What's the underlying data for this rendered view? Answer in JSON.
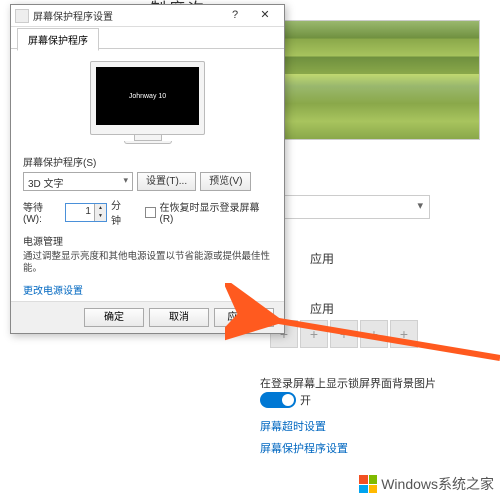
{
  "background": {
    "header_partial": "制度次",
    "section_usage": "应用",
    "section_related": "应用",
    "toggle_label": "在登录屏幕上显示锁屏界面背景图片",
    "toggle_state": "开",
    "link_timeout": "屏幕超时设置",
    "link_screensaver": "屏幕保护程序设置"
  },
  "dialog": {
    "title": "屏幕保护程序设置",
    "tab": "屏幕保护程序",
    "monitor_text": "Johnway 10",
    "section_saver": "屏幕保护程序(S)",
    "combo_value": "3D 文字",
    "btn_settings": "设置(T)...",
    "btn_preview": "预览(V)",
    "wait_label": "等待(W):",
    "wait_value": "1",
    "wait_unit": "分钟",
    "resume_checkbox": "在恢复时显示登录屏幕(R)",
    "section_power": "电源管理",
    "power_desc": "通过调整显示亮度和其他电源设置以节省能源或提供最佳性能。",
    "power_link": "更改电源设置",
    "btn_ok": "确定",
    "btn_cancel": "取消",
    "btn_apply": "应用(A)"
  },
  "watermark": {
    "text": "Windows系统之家"
  }
}
